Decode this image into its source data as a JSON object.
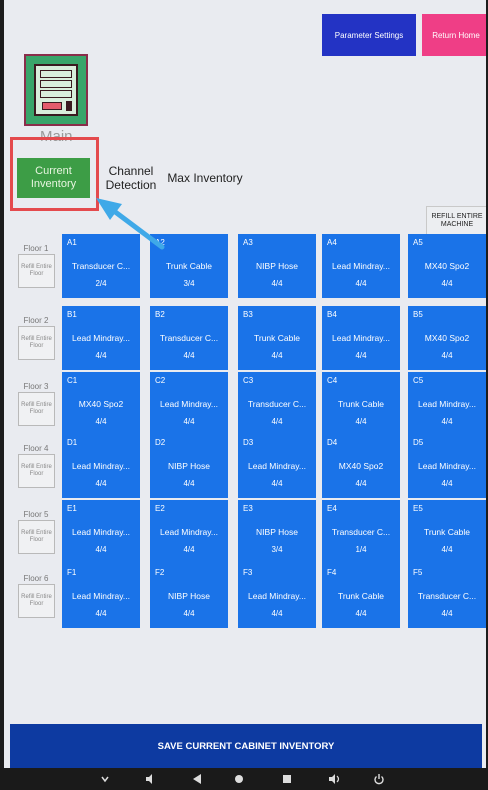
{
  "header": {
    "param_label": "Parameter Settings",
    "home_label": "Return Home"
  },
  "logo": {
    "label": "Main"
  },
  "tabs": {
    "current": "Current Inventory",
    "channel": "Channel Detection",
    "max": "Max Inventory"
  },
  "refill_all_label": "REFILL ENTIRE MACHINE",
  "floors": [
    {
      "label": "Floor 1",
      "refill": "Refill Entire Floor",
      "cells": [
        {
          "id": "A1",
          "name": "Transducer C...",
          "count": "2/4"
        },
        {
          "id": "A2",
          "name": "Trunk Cable",
          "count": "3/4"
        },
        {
          "id": "A3",
          "name": "NIBP Hose",
          "count": "4/4"
        },
        {
          "id": "A4",
          "name": "Lead Mindray...",
          "count": "4/4"
        },
        {
          "id": "A5",
          "name": "MX40 Spo2",
          "count": "4/4"
        }
      ]
    },
    {
      "label": "Floor 2",
      "refill": "Refill Entire Floor",
      "cells": [
        {
          "id": "B1",
          "name": "Lead Mindray...",
          "count": "4/4"
        },
        {
          "id": "B2",
          "name": "Transducer C...",
          "count": "4/4"
        },
        {
          "id": "B3",
          "name": "Trunk Cable",
          "count": "4/4"
        },
        {
          "id": "B4",
          "name": "Lead Mindray...",
          "count": "4/4"
        },
        {
          "id": "B5",
          "name": "MX40 Spo2",
          "count": "4/4"
        }
      ]
    },
    {
      "label": "Floor 3",
      "refill": "Refill Entire Floor",
      "cells": [
        {
          "id": "C1",
          "name": "MX40 Spo2",
          "count": "4/4"
        },
        {
          "id": "C2",
          "name": "Lead Mindray...",
          "count": "4/4"
        },
        {
          "id": "C3",
          "name": "Transducer C...",
          "count": "4/4"
        },
        {
          "id": "C4",
          "name": "Trunk Cable",
          "count": "4/4"
        },
        {
          "id": "C5",
          "name": "Lead Mindray...",
          "count": "4/4"
        }
      ]
    },
    {
      "label": "Floor 4",
      "refill": "Refill Entire Floor",
      "cells": [
        {
          "id": "D1",
          "name": "Lead Mindray...",
          "count": "4/4"
        },
        {
          "id": "D2",
          "name": "NIBP Hose",
          "count": "4/4"
        },
        {
          "id": "D3",
          "name": "Lead Mindray...",
          "count": "4/4"
        },
        {
          "id": "D4",
          "name": "MX40 Spo2",
          "count": "4/4"
        },
        {
          "id": "D5",
          "name": "Lead Mindray...",
          "count": "4/4"
        }
      ]
    },
    {
      "label": "Floor 5",
      "refill": "Refill Entire Floor",
      "cells": [
        {
          "id": "E1",
          "name": "Lead Mindray...",
          "count": "4/4"
        },
        {
          "id": "E2",
          "name": "Lead Mindray...",
          "count": "4/4"
        },
        {
          "id": "E3",
          "name": "NIBP Hose",
          "count": "3/4"
        },
        {
          "id": "E4",
          "name": "Transducer C...",
          "count": "1/4"
        },
        {
          "id": "E5",
          "name": "Trunk Cable",
          "count": "4/4"
        }
      ]
    },
    {
      "label": "Floor 6",
      "refill": "Refill Entire Floor",
      "cells": [
        {
          "id": "F1",
          "name": "Lead Mindray...",
          "count": "4/4"
        },
        {
          "id": "F2",
          "name": "NIBP Hose",
          "count": "4/4"
        },
        {
          "id": "F3",
          "name": "Lead Mindray...",
          "count": "4/4"
        },
        {
          "id": "F4",
          "name": "Trunk Cable",
          "count": "4/4"
        },
        {
          "id": "F5",
          "name": "Transducer C...",
          "count": "4/4"
        }
      ]
    }
  ],
  "save_label": "SAVE CURRENT CABINET INVENTORY",
  "colors": {
    "cell": "#1a73e8",
    "tab_active": "#3d9d46",
    "save": "#0d3aa1",
    "param": "#2333c4",
    "home": "#ef3e86",
    "highlight": "#e44a4d",
    "arrow": "#3fa9e8"
  },
  "icons": [
    "vending-machine-icon",
    "chevron-down-icon",
    "volume-down-icon",
    "back-icon",
    "home-icon",
    "recents-icon",
    "volume-up-icon",
    "power-icon"
  ]
}
